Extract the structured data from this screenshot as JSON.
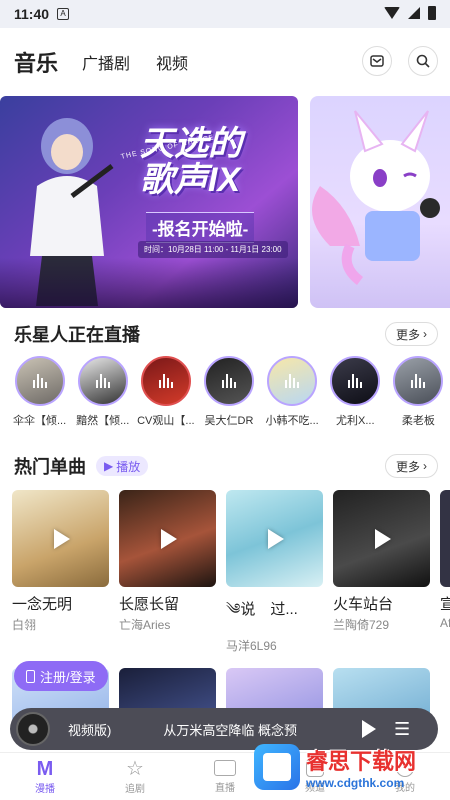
{
  "status": {
    "time": "11:40"
  },
  "header": {
    "title": "音乐",
    "tab_radio": "广播剧",
    "tab_video": "视频"
  },
  "banner": {
    "title_line1": "天选的",
    "title_line2": "歌声IX",
    "song_of_choice": "THE SONG OF CHOICE",
    "register": "-报名开始啦-",
    "time": "时间：10月28日 11:00 - 11月1日 23:00"
  },
  "live_section": {
    "title": "乐星人正在直播",
    "more": "更多",
    "items": [
      {
        "name": "伞伞【倾..."
      },
      {
        "name": "黯然【倾..."
      },
      {
        "name": "CV观山【..."
      },
      {
        "name": "吴大仁DR"
      },
      {
        "name": "小韩不吃..."
      },
      {
        "name": "尤利X..."
      },
      {
        "name": "柔老板"
      }
    ]
  },
  "hot_section": {
    "title": "热门单曲",
    "play_tag": "播放",
    "more": "更多",
    "songs": [
      {
        "title": "一念无明",
        "artist": "白翎"
      },
      {
        "title": "长愿长留",
        "artist": "亡海Aries"
      },
      {
        "title": "༄说　过...",
        "artist": "马洋6L96"
      },
      {
        "title": "火车站台",
        "artist": "兰陶倚729"
      },
      {
        "title": "宣",
        "artist": "Af"
      }
    ]
  },
  "login_button": "注册/登录",
  "player": {
    "text": "视频版)　　　　从万米高空降临 概念预"
  },
  "tabbar": {
    "tab1": "漫播",
    "tab2": "追剧",
    "tab3": "直播",
    "tab4": "频道",
    "tab5": "我的"
  },
  "watermark": {
    "line1": "睿思下载网",
    "line2": "www.cdgthk.com"
  },
  "colors": {
    "accent": "#7a5cf0",
    "player_bg": "#4c4c56"
  }
}
